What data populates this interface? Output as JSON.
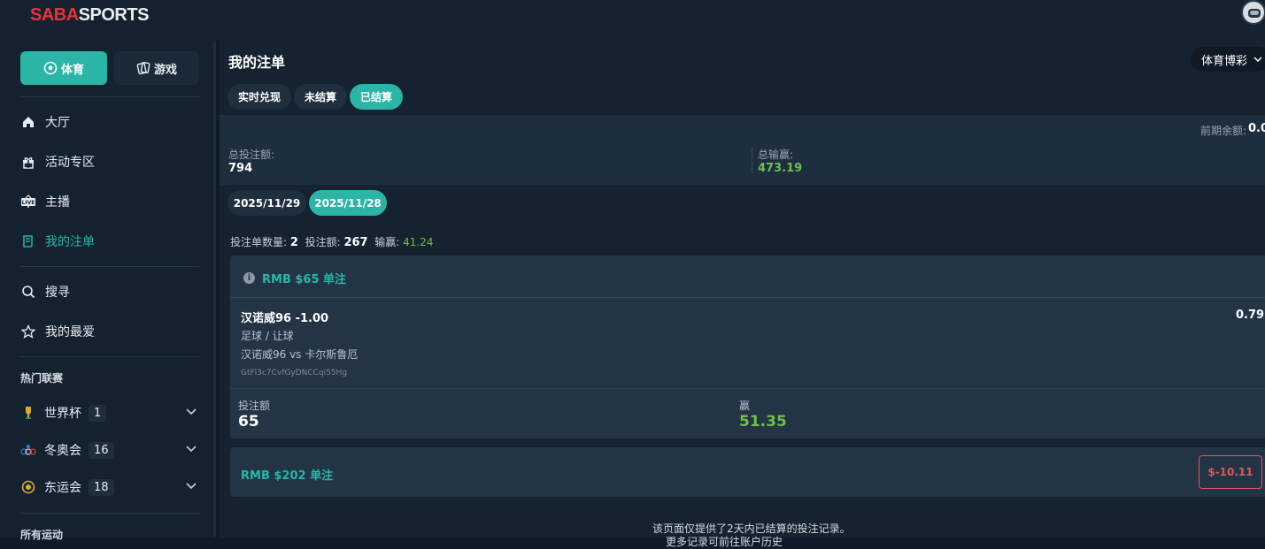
{
  "app": {
    "logo_saba": "SABA",
    "logo_sports": "SPORTS"
  },
  "sidebar": {
    "segments": [
      {
        "label": "体育"
      },
      {
        "label": "游戏"
      }
    ],
    "nav": [
      {
        "label": "大厅",
        "icon": "home-icon"
      },
      {
        "label": "活动专区",
        "icon": "gift-icon"
      },
      {
        "label": "主播",
        "icon": "live-icon"
      },
      {
        "label": "我的注单",
        "icon": "ticket-icon",
        "active": true
      },
      {
        "label": "搜寻",
        "icon": "search-icon"
      },
      {
        "label": "我的最爱",
        "icon": "star-icon"
      }
    ],
    "hot_leagues_label": "热门联赛",
    "leagues": [
      {
        "label": "世界杯",
        "count": "1",
        "icon": "trophy-icon"
      },
      {
        "label": "冬奥会",
        "count": "16",
        "icon": "olympic-rings-icon"
      },
      {
        "label": "东运会",
        "count": "18",
        "icon": "emblem-icon"
      }
    ],
    "all_sports_label": "所有运动"
  },
  "main": {
    "title": "我的注单",
    "dropdown": "体育博彩",
    "tabs": [
      {
        "label": "实时兑现"
      },
      {
        "label": "未结算"
      },
      {
        "label": "已结算",
        "active": true
      }
    ],
    "summary": {
      "prev_balance_label": "前期余额:",
      "prev_balance_value": "0.0",
      "total_stake_label": "总投注额:",
      "total_stake_value": "794",
      "total_winloss_label": "总输赢:",
      "total_winloss_value": "473.19"
    },
    "dates": [
      {
        "label": "2025/11/29"
      },
      {
        "label": "2025/11/28",
        "active": true
      }
    ],
    "stats": {
      "count_label": "投注单数量:",
      "count_value": "2",
      "stake_label": "投注额:",
      "stake_value": "267",
      "winloss_label": "输赢:",
      "winloss_value": "41.24"
    },
    "bets": [
      {
        "header": "RMB $65 单注",
        "selection": "汉诺威96  -1.00",
        "odds": "0.79",
        "market": "足球 / 让球",
        "match": "汉诺威96 vs 卡尔斯鲁厄",
        "id": "GtFl3c7CvfGyDNCCqi55Hg",
        "stake_label": "投注额",
        "stake_value": "65",
        "result_label": "赢",
        "result_value": "51.35"
      },
      {
        "header": "RMB $202 单注",
        "result_value": "$-10.11"
      }
    ],
    "footer_note": "该页面仅提供了2天内已结算的投注记录。",
    "footer_note_2": "更多记录可前往账户历史"
  },
  "colors": {
    "accent": "#2bb5a6",
    "win": "#6fbf4a",
    "loss": "#e0565b",
    "brand_red": "#e6333a"
  }
}
